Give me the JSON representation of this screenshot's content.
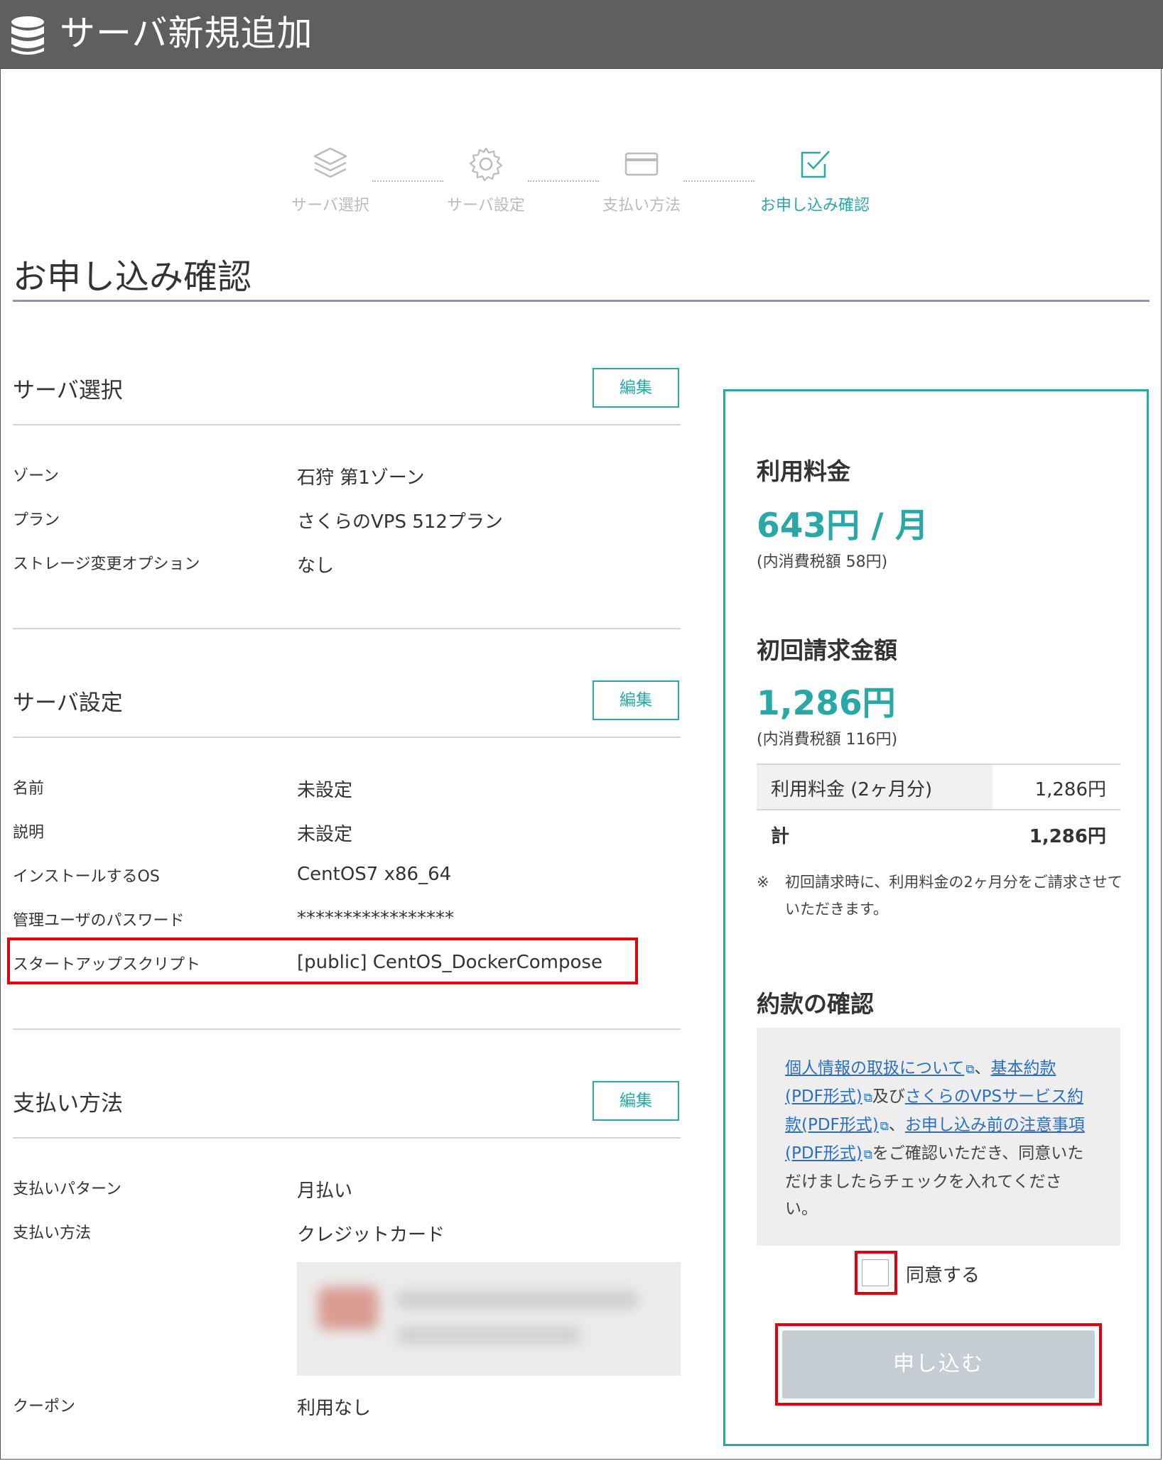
{
  "window": {
    "title": "サーバ新規追加",
    "icon": "database-icon"
  },
  "steps": [
    {
      "label": "サーバ選択",
      "icon": "layers-icon",
      "active": false
    },
    {
      "label": "サーバ設定",
      "icon": "gear-icon",
      "active": false
    },
    {
      "label": "支払い方法",
      "icon": "credit-card-icon",
      "active": false
    },
    {
      "label": "お申し込み確認",
      "icon": "check-square-icon",
      "active": true
    }
  ],
  "page": {
    "title": "お申し込み確認"
  },
  "sections": {
    "server_select": {
      "title": "サーバ選択",
      "edit_label": "編集",
      "rows": [
        {
          "key": "ゾーン",
          "value": "石狩 第1ゾーン"
        },
        {
          "key": "プラン",
          "value": "さくらのVPS 512プラン"
        },
        {
          "key": "ストレージ変更オプション",
          "value": "なし"
        }
      ]
    },
    "server_settings": {
      "title": "サーバ設定",
      "edit_label": "編集",
      "rows": [
        {
          "key": "名前",
          "value": "未設定"
        },
        {
          "key": "説明",
          "value": "未設定"
        },
        {
          "key": "インストールするOS",
          "value": "CentOS7 x86_64"
        },
        {
          "key": "管理ユーザのパスワード",
          "value": "*****************"
        },
        {
          "key": "スタートアップスクリプト",
          "value": "[public] CentOS_DockerCompose"
        }
      ]
    },
    "payment": {
      "title": "支払い方法",
      "edit_label": "編集",
      "rows": [
        {
          "key": "支払いパターン",
          "value": "月払い"
        },
        {
          "key": "支払い方法",
          "value": "クレジットカード"
        },
        {
          "key": "クーポン",
          "value": "利用なし"
        }
      ]
    }
  },
  "summary": {
    "usage_fee_heading": "利用料金",
    "usage_fee_price": "643円 / 月",
    "usage_fee_tax": "(内消費税額 58円)",
    "initial_heading": "初回請求金額",
    "initial_price": "1,286円",
    "initial_tax": "(内消費税額 116円)",
    "table": {
      "row_label": "利用料金 (2ヶ月分)",
      "row_value": "1,286円",
      "total_label": "計",
      "total_value": "1,286円"
    },
    "note_mark": "※",
    "note": "初回請求時に、利用料金の2ヶ月分をご請求させていただきます。",
    "terms_heading": "約款の確認",
    "terms": {
      "link1": "個人情報の取扱について",
      "sep1": "、",
      "link2": "基本約款(PDF形式)",
      "sep2": "及び",
      "link3": "さくらのVPSサービス約款(PDF形式)",
      "sep3": "、",
      "link4": "お申し込み前の注意事項(PDF形式)",
      "tail": "をご確認いただき、同意いただけましたらチェックを入れてください。"
    },
    "agree_label": "同意する",
    "agree_checked": false,
    "submit_label": "申し込む"
  },
  "colors": {
    "accent": "#2aa8a8",
    "highlight": "#e3000f",
    "titlebar": "#5f5f5f",
    "submit_disabled": "#c6ccd3"
  }
}
